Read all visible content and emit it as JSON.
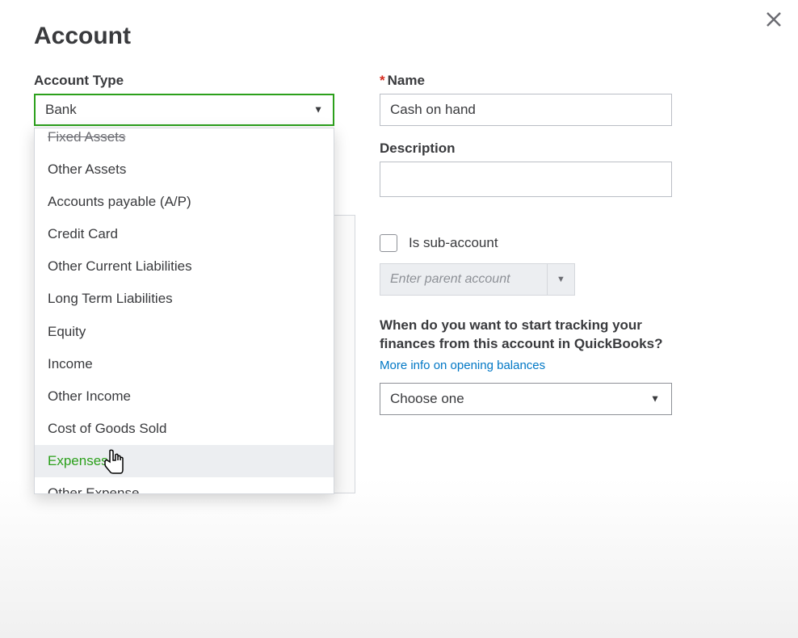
{
  "dialog": {
    "title": "Account"
  },
  "left": {
    "account_type_label": "Account Type",
    "selected_value": "Bank",
    "options": {
      "partial": "Fixed Assets",
      "o1": "Other Assets",
      "o2": "Accounts payable (A/P)",
      "o3": "Credit Card",
      "o4": "Other Current Liabilities",
      "o5": "Long Term Liabilities",
      "o6": "Equity",
      "o7": "Income",
      "o8": "Other Income",
      "o9": "Cost of Goods Sold",
      "o10": "Expenses",
      "o11": "Other Expense"
    }
  },
  "right": {
    "name_label": "Name",
    "name_value": "Cash on hand",
    "description_label": "Description",
    "description_value": "",
    "sub_account_label": "Is sub-account",
    "parent_placeholder": "Enter parent account",
    "tracking_question": "When do you want to start tracking your finances from this account in QuickBooks?",
    "more_info": "More info on opening balances",
    "choose_placeholder": "Choose one"
  }
}
